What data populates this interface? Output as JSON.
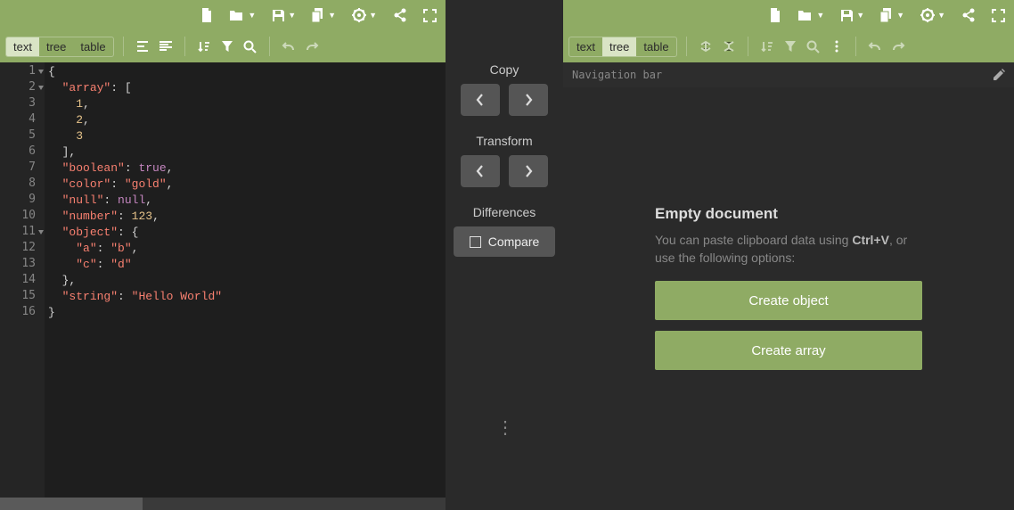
{
  "mode_tabs": [
    "text",
    "tree",
    "table"
  ],
  "left_active_mode": "text",
  "right_active_mode": "tree",
  "topbar_icons": [
    "new-file-icon",
    "open-icon",
    "save-icon",
    "copy-icon",
    "settings-icon",
    "share-icon",
    "fullscreen-icon"
  ],
  "toolbar_icons_left": [
    "expand-icon",
    "collapse-icon",
    "sort-icon",
    "filter-icon",
    "search-icon"
  ],
  "toolbar_icons_left_dim": [
    "undo-icon",
    "redo-icon"
  ],
  "toolbar_icons_right": [
    "expand-icon",
    "collapse-icon",
    "sort-icon",
    "filter-icon",
    "search-icon",
    "more-icon"
  ],
  "toolbar_icons_right_dim": [
    "undo-icon",
    "redo-icon"
  ],
  "code_lines": 16,
  "json_content": {
    "array": [
      1,
      2,
      3
    ],
    "boolean": true,
    "color": "gold",
    "null": null,
    "number": 123,
    "object": {
      "a": "b",
      "c": "d"
    },
    "string": "Hello World"
  },
  "center": {
    "copy_label": "Copy",
    "transform_label": "Transform",
    "differences_label": "Differences",
    "compare_label": "Compare"
  },
  "right": {
    "nav_placeholder": "Navigation bar",
    "empty_title": "Empty document",
    "empty_desc_pre": "You can paste clipboard data using ",
    "empty_desc_key": "Ctrl+V",
    "empty_desc_post": ", or use the following options:",
    "create_object": "Create object",
    "create_array": "Create array"
  }
}
